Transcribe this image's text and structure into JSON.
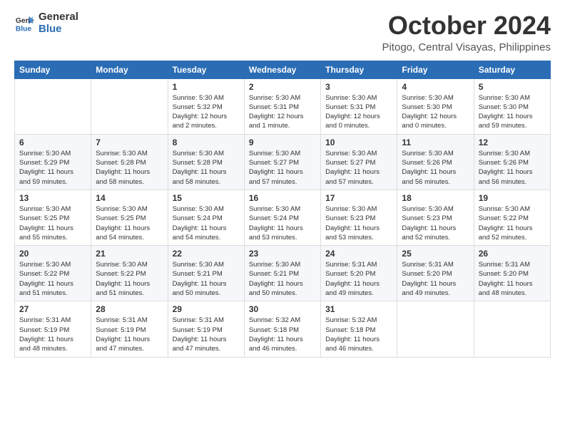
{
  "header": {
    "logo_line1": "General",
    "logo_line2": "Blue",
    "month": "October 2024",
    "location": "Pitogo, Central Visayas, Philippines"
  },
  "weekdays": [
    "Sunday",
    "Monday",
    "Tuesday",
    "Wednesday",
    "Thursday",
    "Friday",
    "Saturday"
  ],
  "weeks": [
    [
      {
        "day": "",
        "info": ""
      },
      {
        "day": "",
        "info": ""
      },
      {
        "day": "1",
        "info": "Sunrise: 5:30 AM\nSunset: 5:32 PM\nDaylight: 12 hours\nand 2 minutes."
      },
      {
        "day": "2",
        "info": "Sunrise: 5:30 AM\nSunset: 5:31 PM\nDaylight: 12 hours\nand 1 minute."
      },
      {
        "day": "3",
        "info": "Sunrise: 5:30 AM\nSunset: 5:31 PM\nDaylight: 12 hours\nand 0 minutes."
      },
      {
        "day": "4",
        "info": "Sunrise: 5:30 AM\nSunset: 5:30 PM\nDaylight: 12 hours\nand 0 minutes."
      },
      {
        "day": "5",
        "info": "Sunrise: 5:30 AM\nSunset: 5:30 PM\nDaylight: 11 hours\nand 59 minutes."
      }
    ],
    [
      {
        "day": "6",
        "info": "Sunrise: 5:30 AM\nSunset: 5:29 PM\nDaylight: 11 hours\nand 59 minutes."
      },
      {
        "day": "7",
        "info": "Sunrise: 5:30 AM\nSunset: 5:28 PM\nDaylight: 11 hours\nand 58 minutes."
      },
      {
        "day": "8",
        "info": "Sunrise: 5:30 AM\nSunset: 5:28 PM\nDaylight: 11 hours\nand 58 minutes."
      },
      {
        "day": "9",
        "info": "Sunrise: 5:30 AM\nSunset: 5:27 PM\nDaylight: 11 hours\nand 57 minutes."
      },
      {
        "day": "10",
        "info": "Sunrise: 5:30 AM\nSunset: 5:27 PM\nDaylight: 11 hours\nand 57 minutes."
      },
      {
        "day": "11",
        "info": "Sunrise: 5:30 AM\nSunset: 5:26 PM\nDaylight: 11 hours\nand 56 minutes."
      },
      {
        "day": "12",
        "info": "Sunrise: 5:30 AM\nSunset: 5:26 PM\nDaylight: 11 hours\nand 56 minutes."
      }
    ],
    [
      {
        "day": "13",
        "info": "Sunrise: 5:30 AM\nSunset: 5:25 PM\nDaylight: 11 hours\nand 55 minutes."
      },
      {
        "day": "14",
        "info": "Sunrise: 5:30 AM\nSunset: 5:25 PM\nDaylight: 11 hours\nand 54 minutes."
      },
      {
        "day": "15",
        "info": "Sunrise: 5:30 AM\nSunset: 5:24 PM\nDaylight: 11 hours\nand 54 minutes."
      },
      {
        "day": "16",
        "info": "Sunrise: 5:30 AM\nSunset: 5:24 PM\nDaylight: 11 hours\nand 53 minutes."
      },
      {
        "day": "17",
        "info": "Sunrise: 5:30 AM\nSunset: 5:23 PM\nDaylight: 11 hours\nand 53 minutes."
      },
      {
        "day": "18",
        "info": "Sunrise: 5:30 AM\nSunset: 5:23 PM\nDaylight: 11 hours\nand 52 minutes."
      },
      {
        "day": "19",
        "info": "Sunrise: 5:30 AM\nSunset: 5:22 PM\nDaylight: 11 hours\nand 52 minutes."
      }
    ],
    [
      {
        "day": "20",
        "info": "Sunrise: 5:30 AM\nSunset: 5:22 PM\nDaylight: 11 hours\nand 51 minutes."
      },
      {
        "day": "21",
        "info": "Sunrise: 5:30 AM\nSunset: 5:22 PM\nDaylight: 11 hours\nand 51 minutes."
      },
      {
        "day": "22",
        "info": "Sunrise: 5:30 AM\nSunset: 5:21 PM\nDaylight: 11 hours\nand 50 minutes."
      },
      {
        "day": "23",
        "info": "Sunrise: 5:30 AM\nSunset: 5:21 PM\nDaylight: 11 hours\nand 50 minutes."
      },
      {
        "day": "24",
        "info": "Sunrise: 5:31 AM\nSunset: 5:20 PM\nDaylight: 11 hours\nand 49 minutes."
      },
      {
        "day": "25",
        "info": "Sunrise: 5:31 AM\nSunset: 5:20 PM\nDaylight: 11 hours\nand 49 minutes."
      },
      {
        "day": "26",
        "info": "Sunrise: 5:31 AM\nSunset: 5:20 PM\nDaylight: 11 hours\nand 48 minutes."
      }
    ],
    [
      {
        "day": "27",
        "info": "Sunrise: 5:31 AM\nSunset: 5:19 PM\nDaylight: 11 hours\nand 48 minutes."
      },
      {
        "day": "28",
        "info": "Sunrise: 5:31 AM\nSunset: 5:19 PM\nDaylight: 11 hours\nand 47 minutes."
      },
      {
        "day": "29",
        "info": "Sunrise: 5:31 AM\nSunset: 5:19 PM\nDaylight: 11 hours\nand 47 minutes."
      },
      {
        "day": "30",
        "info": "Sunrise: 5:32 AM\nSunset: 5:18 PM\nDaylight: 11 hours\nand 46 minutes."
      },
      {
        "day": "31",
        "info": "Sunrise: 5:32 AM\nSunset: 5:18 PM\nDaylight: 11 hours\nand 46 minutes."
      },
      {
        "day": "",
        "info": ""
      },
      {
        "day": "",
        "info": ""
      }
    ]
  ]
}
